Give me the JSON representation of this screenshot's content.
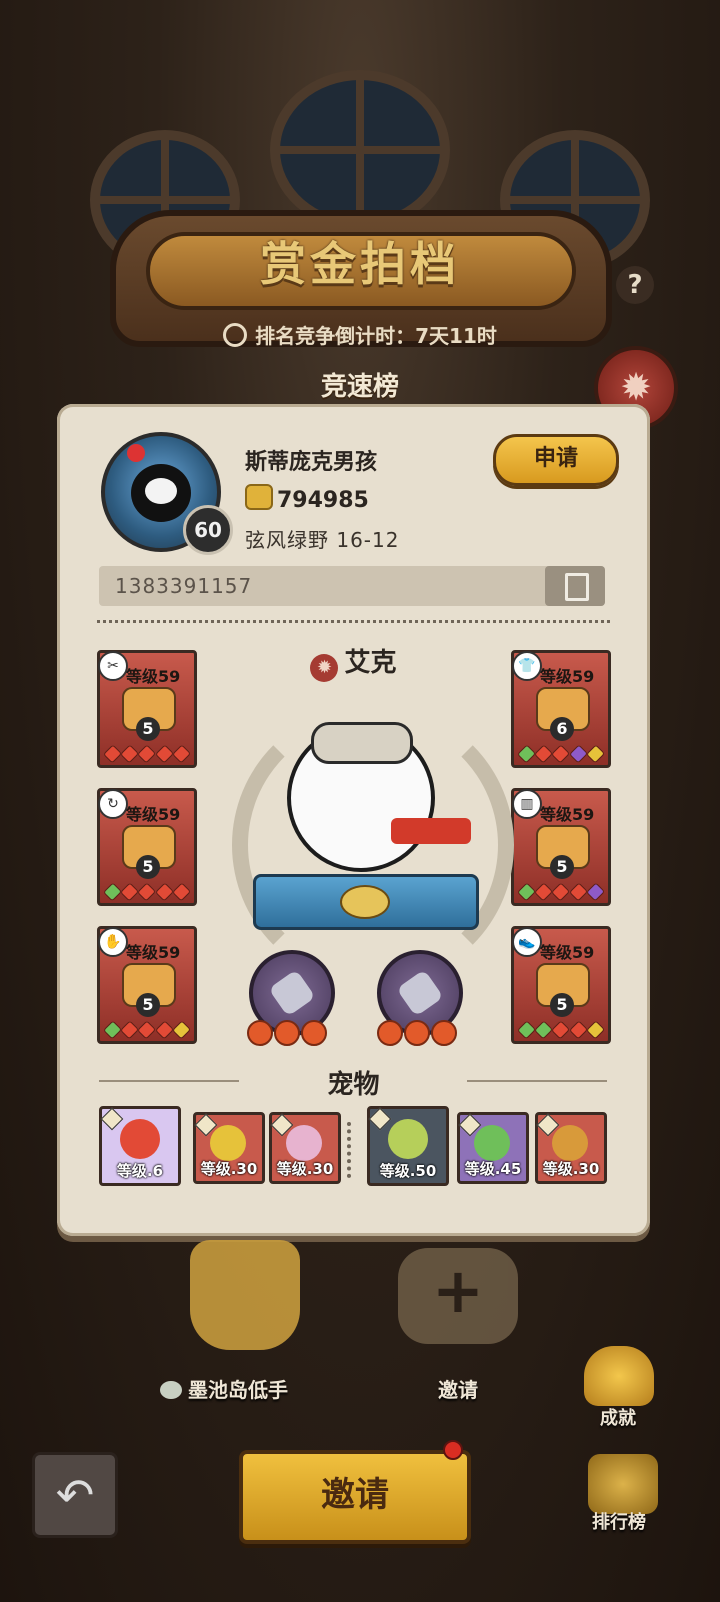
{
  "header": {
    "title": "赏金拍档",
    "countdown": "排名竞争倒计时：7天11时",
    "help_label": "?",
    "tab_label": "竞速榜"
  },
  "player": {
    "name": "斯蒂庞克男孩",
    "power": "794985",
    "stage": "弦风绿野  16-12",
    "level": "60",
    "id": "1383391157",
    "apply_label": "申请"
  },
  "hero": {
    "name": "艾克",
    "skill_stars": [
      3,
      3
    ]
  },
  "equipment": [
    {
      "slot": "left-1",
      "level_label": "等级59",
      "stars": "5",
      "gems": [
        "#e24a36",
        "#e24a36",
        "#e24a36",
        "#e24a36",
        "#e24a36"
      ]
    },
    {
      "slot": "left-2",
      "level_label": "等级59",
      "stars": "5",
      "gems": [
        "#6fbf5a",
        "#e24a36",
        "#e24a36",
        "#e24a36",
        "#e24a36"
      ]
    },
    {
      "slot": "left-3",
      "level_label": "等级59",
      "stars": "5",
      "gems": [
        "#6fbf5a",
        "#e24a36",
        "#e24a36",
        "#e24a36",
        "#e6c23a"
      ]
    },
    {
      "slot": "right-1",
      "level_label": "等级59",
      "stars": "6",
      "gems": [
        "#6fbf5a",
        "#e24a36",
        "#e24a36",
        "#8e5ac8",
        "#e6c23a"
      ]
    },
    {
      "slot": "right-2",
      "level_label": "等级59",
      "stars": "5",
      "gems": [
        "#6fbf5a",
        "#e24a36",
        "#e24a36",
        "#e24a36",
        "#8e5ac8"
      ]
    },
    {
      "slot": "right-3",
      "level_label": "等级59",
      "stars": "5",
      "gems": [
        "#6fbf5a",
        "#6fbf5a",
        "#e24a36",
        "#e24a36",
        "#e6c23a"
      ]
    }
  ],
  "pets_section": {
    "title": "宠物",
    "pets": [
      {
        "level_label": "等级.6",
        "color": "#d9c7f0"
      },
      {
        "level_label": "等级.30",
        "color": "#c85a4c"
      },
      {
        "level_label": "等级.30",
        "color": "#c85a4c"
      },
      {
        "level_label": "等级.50",
        "color": "#4b5560"
      },
      {
        "level_label": "等级.45",
        "color": "#8e72b8"
      },
      {
        "level_label": "等级.30",
        "color": "#c85a4c"
      }
    ]
  },
  "bottom": {
    "partner_label": "墨池岛低手",
    "invite_slot_label": "邀请",
    "achievements_label": "成就",
    "leaderboard_label": "排行榜",
    "invite_button_label": "邀请"
  },
  "colors": {
    "accent_gold": "#e8c877",
    "panel_bg": "#e7dfcf",
    "equip_red": "#c85a4c"
  }
}
